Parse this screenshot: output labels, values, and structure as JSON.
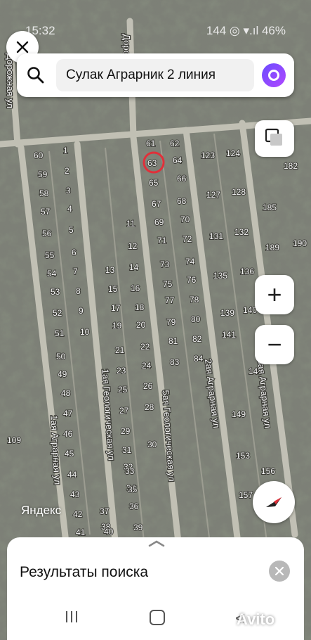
{
  "status_bar": {
    "time": "15:32",
    "indicators": "144 ◎ ▾.ıl 46%"
  },
  "search": {
    "query": "Сулак Аграрник 2 линия"
  },
  "map": {
    "watermark": "Яндекс",
    "street_labels": [
      "2ая Аграрная ул",
      "3ая Аграрная ул",
      "1ая Аграрная ул",
      "1ая Геологическая ул",
      "5ая Геологическая ул",
      "Дорожная ул",
      "Дорожна"
    ],
    "plot_numbers": [
      "60",
      "61",
      "62",
      "63",
      "64",
      "65",
      "66",
      "67",
      "68",
      "69",
      "70",
      "71",
      "72",
      "73",
      "74",
      "75",
      "76",
      "77",
      "78",
      "79",
      "80",
      "81",
      "82",
      "83",
      "84",
      "1",
      "2",
      "3",
      "4",
      "5",
      "6",
      "7",
      "8",
      "9",
      "10",
      "11",
      "12",
      "13",
      "14",
      "15",
      "16",
      "17",
      "18",
      "19",
      "20",
      "21",
      "22",
      "23",
      "24",
      "25",
      "26",
      "27",
      "28",
      "29",
      "30",
      "31",
      "32",
      "33",
      "34",
      "35",
      "36",
      "37",
      "38",
      "39",
      "40",
      "41",
      "42",
      "43",
      "44",
      "45",
      "46",
      "47",
      "48",
      "49",
      "50",
      "51",
      "52",
      "53",
      "54",
      "55",
      "56",
      "57",
      "58",
      "59",
      "123",
      "124",
      "127",
      "128",
      "131",
      "132",
      "135",
      "136",
      "139",
      "140",
      "141",
      "146",
      "149",
      "153",
      "156",
      "157",
      "182",
      "185",
      "189",
      "190",
      "109"
    ],
    "highlighted_plot": "63"
  },
  "controls": {
    "zoom_in": "+",
    "zoom_out": "−"
  },
  "results_sheet": {
    "title": "Результаты поиска"
  },
  "watermark_brand": "Avito"
}
